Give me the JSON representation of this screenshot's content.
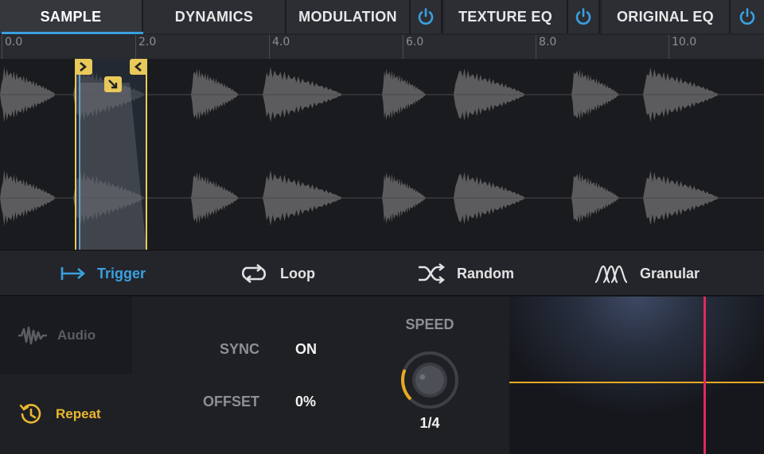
{
  "tabs": [
    {
      "label": "SAMPLE",
      "active": true
    },
    {
      "label": "DYNAMICS",
      "active": false
    },
    {
      "label": "MODULATION",
      "active": false,
      "power": true
    },
    {
      "label": "TEXTURE EQ",
      "active": false,
      "power": true
    },
    {
      "label": "ORIGINAL EQ",
      "active": false,
      "power": true
    }
  ],
  "ruler": {
    "labels": [
      "0.0",
      "2.0",
      "4.0",
      "6.0",
      "8.0",
      "10.0"
    ]
  },
  "modes": [
    {
      "label": "Trigger",
      "icon": "arrow-to-line-icon",
      "active": true
    },
    {
      "label": "Loop",
      "icon": "loop-icon",
      "active": false
    },
    {
      "label": "Random",
      "icon": "shuffle-icon",
      "active": false
    },
    {
      "label": "Granular",
      "icon": "granular-icon",
      "active": false
    }
  ],
  "side": {
    "audio_label": "Audio",
    "repeat_label": "Repeat"
  },
  "params": {
    "sync_label": "SYNC",
    "sync_value": "ON",
    "offset_label": "OFFSET",
    "offset_value": "0%"
  },
  "speed": {
    "label": "SPEED",
    "value": "1/4",
    "knob_fraction": 0.25
  },
  "colors": {
    "accent_blue": "#3aa0e0",
    "accent_yellow": "#e8b730",
    "xy_horizontal": "#e8a924",
    "xy_vertical": "#e02a5c"
  }
}
